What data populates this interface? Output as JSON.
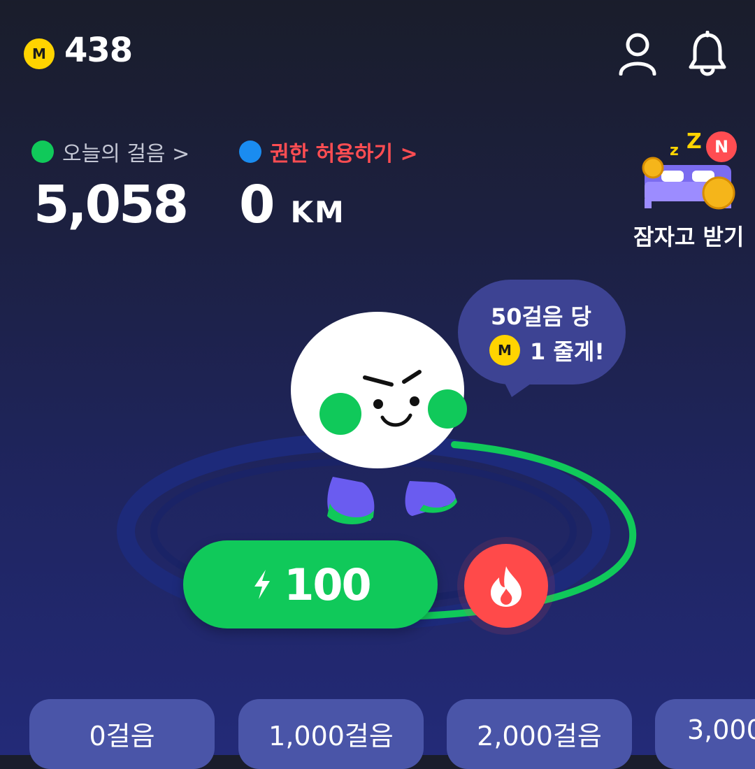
{
  "header": {
    "coin_icon_letter": "M",
    "coin_count": "438",
    "icons": [
      "profile-icon",
      "bell-icon"
    ]
  },
  "stats": {
    "steps_label": "오늘의 걸음 >",
    "steps_value": "5,058",
    "permission_label": "권한 허용하기 >",
    "distance_value": "0",
    "distance_unit": "KM",
    "colors": {
      "steps_dot": "#10c95a",
      "permission_dot": "#1a8cf0",
      "permission_text": "#ff4d52"
    }
  },
  "sleep_reward": {
    "label": "잠자고 받기",
    "badge": "N",
    "z_text": "zZ"
  },
  "bubble": {
    "line1": "50걸음 당",
    "coin_letter": "M",
    "line2": "1 줄게!"
  },
  "boost": {
    "value": "100",
    "icon": "lightning-icon",
    "fire_icon": "fire-icon"
  },
  "milestones": [
    "0걸음",
    "1,000걸음",
    "2,000걸음",
    "3,000"
  ]
}
